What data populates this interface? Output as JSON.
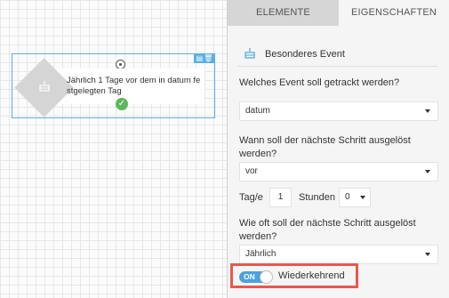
{
  "canvas": {
    "node": {
      "text": "Jährlich 1 Tage vor dem in datum fe stgelegten Tag",
      "toolbar_icons": [
        "document-icon",
        "trash-icon"
      ]
    }
  },
  "panel": {
    "tabs": [
      {
        "label": "ELEMENTE",
        "active": false
      },
      {
        "label": "EIGENSCHAFTEN",
        "active": true
      }
    ],
    "section_title": "Besonderes Event",
    "event_question": "Welches Event soll getrackt werden?",
    "event_value": "datum",
    "trigger_question": "Wann soll der nächste Schritt ausgelöst werden?",
    "trigger_value": "vor",
    "days_label": "Tag/e",
    "days_value": "1",
    "hours_label": "Stunden",
    "hours_value": "0",
    "frequency_question": "Wie oft soll der nächste Schritt ausgelöst werden?",
    "frequency_value": "Jährlich",
    "toggle_state": "ON",
    "toggle_label": "Wiederkehrend"
  },
  "colors": {
    "accent": "#4aa3df",
    "highlight": "#e9574f",
    "success": "#5cb85c"
  }
}
